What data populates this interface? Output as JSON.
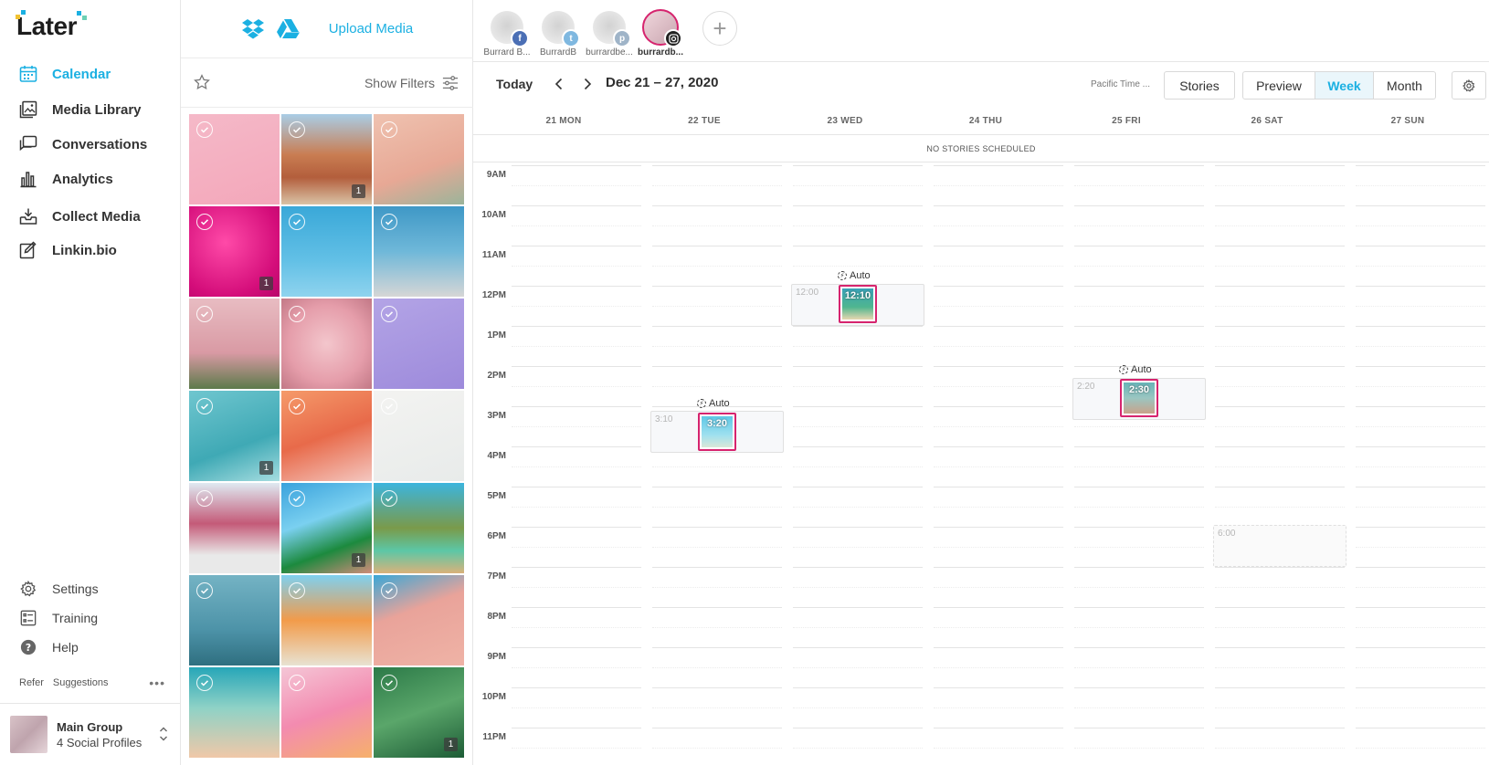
{
  "brand": {
    "name": "Later",
    "accent": "#1bb0e2",
    "instagram_pink": "#d6246e"
  },
  "sidebar": {
    "nav": [
      {
        "label": "Calendar",
        "icon": "calendar-icon",
        "active": true
      },
      {
        "label": "Media Library",
        "icon": "media-library-icon",
        "active": false
      },
      {
        "label": "Conversations",
        "icon": "conversations-icon",
        "active": false
      },
      {
        "label": "Analytics",
        "icon": "analytics-icon",
        "active": false
      },
      {
        "label": "Collect Media",
        "icon": "collect-media-icon",
        "active": false
      },
      {
        "label": "Linkin.bio",
        "icon": "linkin-bio-icon",
        "active": false
      }
    ],
    "utility": [
      {
        "label": "Settings",
        "icon": "gear-icon"
      },
      {
        "label": "Training",
        "icon": "checklist-icon"
      },
      {
        "label": "Help",
        "icon": "help-icon"
      }
    ],
    "refer": "Refer",
    "suggestions": "Suggestions",
    "group": {
      "name": "Main Group",
      "profiles": "4 Social Profiles"
    }
  },
  "media": {
    "upload_label": "Upload Media",
    "show_filters": "Show Filters",
    "tiles": [
      {
        "bg": "linear-gradient(160deg,#f5b9c8,#f3a7ba)",
        "count": ""
      },
      {
        "bg": "linear-gradient(180deg,#a9cde6 0%,#c97d52 45%,#b35e3c 70%,#d9c3a6 100%)",
        "count": "1"
      },
      {
        "bg": "linear-gradient(160deg,#efc2b0,#e7a895 60%,#9bb49a)",
        "count": ""
      },
      {
        "bg": "radial-gradient(circle at 40% 40%,#ff4aa8,#d40d7a 70%,#b8066a)",
        "count": "1"
      },
      {
        "bg": "linear-gradient(180deg,#3aa8d8,#62c0e6 60%,#8fd3ee)",
        "count": ""
      },
      {
        "bg": "linear-gradient(180deg,#3f98c6,#6fb8d9 50%,#d6d6d6)",
        "count": ""
      },
      {
        "bg": "linear-gradient(180deg,#e8bcc2,#d99aa4 60%,#5c7a4a)",
        "count": ""
      },
      {
        "bg": "radial-gradient(circle,#f3c6cc,#e59daa 60%,#c27886)",
        "count": ""
      },
      {
        "bg": "linear-gradient(160deg,#b3a4e6,#9d8adb)",
        "count": ""
      },
      {
        "bg": "linear-gradient(160deg,#6fc6cf,#3fa9b5 60%,#a6dde0)",
        "count": "1"
      },
      {
        "bg": "linear-gradient(160deg,#f59a6a,#e86a4a 50%,#f4c7c0)",
        "count": ""
      },
      {
        "bg": "linear-gradient(160deg,#f3f3f1,#e8ebea)",
        "count": ""
      },
      {
        "bg": "linear-gradient(180deg,#dfeaf2,#c45a78 45%,#e9e9e9 80%)",
        "count": ""
      },
      {
        "bg": "linear-gradient(160deg,#3aa2dc,#7ad0f0 40%,#1c8a3e 70%,#d08b7a)",
        "count": "1"
      },
      {
        "bg": "linear-gradient(180deg,#3cb5dd,#7a9a4a 50%,#5cc7a6 75%,#d9b27a)",
        "count": ""
      },
      {
        "bg": "linear-gradient(180deg,#74b3c4,#4d93a8 60%,#2f6f80)",
        "count": ""
      },
      {
        "bg": "linear-gradient(180deg,#7fd0ef,#f29b4a 50%,#e8e2d2)",
        "count": ""
      },
      {
        "bg": "linear-gradient(160deg,#3ba7d6,#e9a39a 40%,#efb3a6)",
        "count": ""
      },
      {
        "bg": "linear-gradient(180deg,#27a6b8,#8fd2c6 45%,#f0c8a8)",
        "count": ""
      },
      {
        "bg": "linear-gradient(160deg,#f4c6d6,#f38bb0 50%,#f6b06b)",
        "count": ""
      },
      {
        "bg": "linear-gradient(160deg,#2c7a48,#5aa66a 50%,#1d5c36)",
        "count": "1"
      }
    ]
  },
  "profiles": [
    {
      "name": "Burrard B...",
      "network": "facebook",
      "color": "#4b6fb5",
      "glyph": "f",
      "active": false
    },
    {
      "name": "BurrardB",
      "network": "twitter",
      "color": "#7fb8e0",
      "glyph": "t",
      "active": false
    },
    {
      "name": "burrardbe...",
      "network": "pinterest",
      "color": "#9fb4c8",
      "glyph": "p",
      "active": false
    },
    {
      "name": "burrardb...",
      "network": "instagram",
      "color": "#222222",
      "glyph": "◎",
      "active": true
    }
  ],
  "toolbar": {
    "today": "Today",
    "range": "Dec 21 – 27, 2020",
    "timezone": "Pacific Time ...",
    "stories": "Stories",
    "preview": "Preview",
    "week": "Week",
    "month": "Month"
  },
  "days": [
    "21 MON",
    "22 TUE",
    "23 WED",
    "24 THU",
    "25 FRI",
    "26 SAT",
    "27 SUN"
  ],
  "no_stories": "NO STORIES SCHEDULED",
  "hours": [
    "9AM",
    "10AM",
    "11AM",
    "12PM",
    "1PM",
    "2PM",
    "3PM",
    "4PM",
    "5PM",
    "6PM",
    "7PM",
    "8PM",
    "9PM",
    "10PM",
    "11PM"
  ],
  "slots": [
    {
      "day": 1,
      "hour": 15.17,
      "label": "3:10",
      "dashed": false
    },
    {
      "day": 2,
      "hour": 12.0,
      "label": "12:00",
      "dashed": false
    },
    {
      "day": 4,
      "hour": 14.33,
      "label": "2:20",
      "dashed": false
    },
    {
      "day": 5,
      "hour": 18.0,
      "label": "6:00",
      "dashed": true
    }
  ],
  "posts": [
    {
      "day": 1,
      "hour": 15.33,
      "time": "3:20",
      "auto": "Auto",
      "bg": "linear-gradient(180deg,#5ec8e6,#9ee0ef 60%,#d9e8d8)"
    },
    {
      "day": 2,
      "hour": 12.17,
      "time": "12:10",
      "auto": "Auto",
      "bg": "linear-gradient(180deg,#3aa2b8,#4fb68f 60%,#e7d7b0)"
    },
    {
      "day": 4,
      "hour": 14.5,
      "time": "2:30",
      "auto": "Auto",
      "bg": "linear-gradient(180deg,#68b3b8,#9bc6c1 50%,#c9a28a)"
    }
  ]
}
